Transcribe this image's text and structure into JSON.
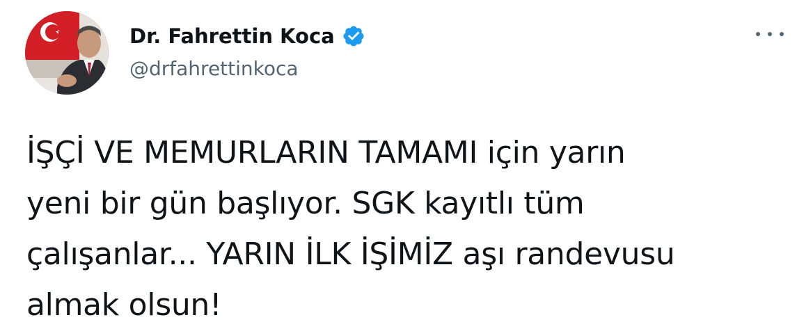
{
  "tweet": {
    "author": {
      "display_name": "Dr. Fahrettin Koca",
      "handle": "@drfahrettinkoca",
      "verified": true,
      "avatar": "profile-photo-with-flag"
    },
    "more_icon": "more-horizontal-icon",
    "body_lines": [
      "İŞÇİ VE MEMURLARIN TAMAMI için yarın",
      "yeni bir gün başlıyor. SGK kayıtlı tüm",
      "çalışanlar... YARIN İLK İŞİMİZ aşı randevusu",
      "almak olsun!"
    ]
  },
  "colors": {
    "text_primary": "#0f1419",
    "text_secondary": "#536471",
    "verified_blue": "#1d9bf0",
    "flag_red": "#d21f26"
  }
}
